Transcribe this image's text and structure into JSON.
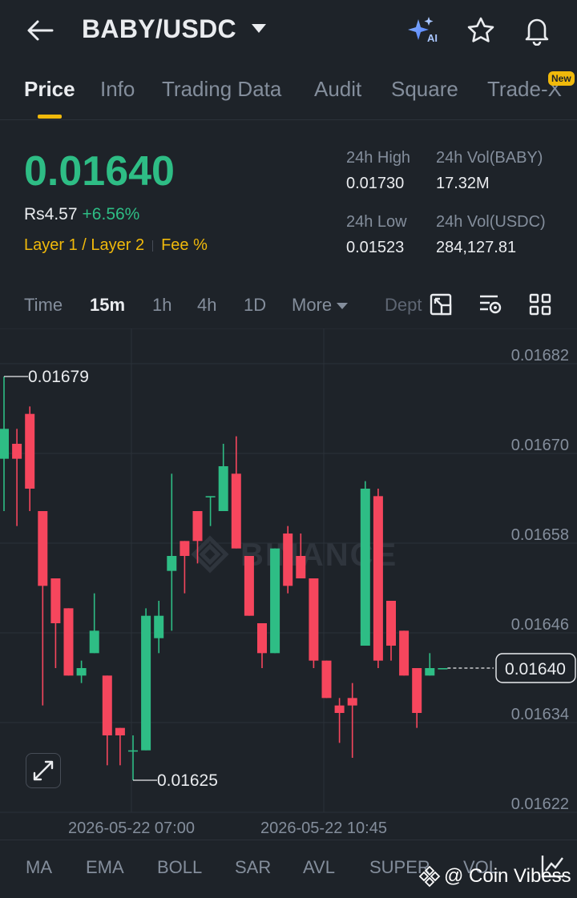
{
  "header": {
    "pair": "BABY/USDC",
    "ai_label": "AI"
  },
  "tabs": [
    {
      "label": "Price",
      "active": true
    },
    {
      "label": "Info"
    },
    {
      "label": "Trading Data"
    },
    {
      "label": "Audit"
    },
    {
      "label": "Square"
    },
    {
      "label": "Trade-X",
      "badge": "New"
    }
  ],
  "price": {
    "last": "0.01640",
    "fiat": "Rs4.57",
    "change": "+6.56%",
    "tag1": "Layer 1 / Layer 2",
    "tag2": "Fee %"
  },
  "stats": {
    "high_label": "24h High",
    "high_value": "0.01730",
    "vol_base_label": "24h Vol(BABY)",
    "vol_base_value": "17.32M",
    "low_label": "24h Low",
    "low_value": "0.01523",
    "vol_quote_label": "24h Vol(USDC)",
    "vol_quote_value": "284,127.81"
  },
  "timeframes": {
    "time": "Time",
    "m15": "15m",
    "h1": "1h",
    "h4": "4h",
    "d1": "1D",
    "more": "More",
    "depth": "Dept"
  },
  "colors": {
    "up": "#2ebd85",
    "down": "#f6465d",
    "accent": "#f0b90b",
    "bg": "#1e2329"
  },
  "chart_data": {
    "type": "candlestick",
    "yticks": [
      "0.01682",
      "0.01670",
      "0.01658",
      "0.01646",
      "0.01634",
      "0.01622"
    ],
    "ylim": [
      0.01622,
      0.01682
    ],
    "xticks": [
      "2026-05-22 07:00",
      "2026-05-22 10:45"
    ],
    "high_marker": "0.01679",
    "low_marker": "0.01625",
    "last_price": "0.01640",
    "watermark": "BINANCE",
    "candles": [
      {
        "o": 0.01668,
        "h": 0.01679,
        "l": 0.01661,
        "c": 0.01672
      },
      {
        "o": 0.0167,
        "h": 0.01672,
        "l": 0.01659,
        "c": 0.01668
      },
      {
        "o": 0.01674,
        "h": 0.01675,
        "l": 0.01661,
        "c": 0.01664
      },
      {
        "o": 0.01661,
        "h": 0.01661,
        "l": 0.01635,
        "c": 0.01651
      },
      {
        "o": 0.01652,
        "h": 0.01652,
        "l": 0.0164,
        "c": 0.01646
      },
      {
        "o": 0.01648,
        "h": 0.01648,
        "l": 0.01639,
        "c": 0.01639
      },
      {
        "o": 0.01639,
        "h": 0.01641,
        "l": 0.01638,
        "c": 0.0164
      },
      {
        "o": 0.01642,
        "h": 0.0165,
        "l": 0.01642,
        "c": 0.01645
      },
      {
        "o": 0.01639,
        "h": 0.01639,
        "l": 0.01627,
        "c": 0.01631
      },
      {
        "o": 0.01632,
        "h": 0.01632,
        "l": 0.01627,
        "c": 0.01631
      },
      {
        "o": 0.01629,
        "h": 0.01631,
        "l": 0.01625,
        "c": 0.01629
      },
      {
        "o": 0.01629,
        "h": 0.01648,
        "l": 0.01629,
        "c": 0.01647
      },
      {
        "o": 0.01644,
        "h": 0.01649,
        "l": 0.01642,
        "c": 0.01647
      },
      {
        "o": 0.01653,
        "h": 0.01666,
        "l": 0.01645,
        "c": 0.01655
      },
      {
        "o": 0.01657,
        "h": 0.01657,
        "l": 0.0165,
        "c": 0.01655
      },
      {
        "o": 0.01661,
        "h": 0.01661,
        "l": 0.01654,
        "c": 0.01657
      },
      {
        "o": 0.01663,
        "h": 0.01663,
        "l": 0.01659,
        "c": 0.01663
      },
      {
        "o": 0.01661,
        "h": 0.0167,
        "l": 0.01661,
        "c": 0.01667
      },
      {
        "o": 0.01666,
        "h": 0.01671,
        "l": 0.01656,
        "c": 0.01656
      },
      {
        "o": 0.01655,
        "h": 0.01655,
        "l": 0.01647,
        "c": 0.01647
      },
      {
        "o": 0.01646,
        "h": 0.01646,
        "l": 0.0164,
        "c": 0.01642
      },
      {
        "o": 0.01642,
        "h": 0.01656,
        "l": 0.01642,
        "c": 0.01656
      },
      {
        "o": 0.01658,
        "h": 0.01659,
        "l": 0.0165,
        "c": 0.01651
      },
      {
        "o": 0.01655,
        "h": 0.01658,
        "l": 0.01652,
        "c": 0.01652
      },
      {
        "o": 0.01652,
        "h": 0.01652,
        "l": 0.0164,
        "c": 0.01641
      },
      {
        "o": 0.01641,
        "h": 0.01641,
        "l": 0.01636,
        "c": 0.01636
      },
      {
        "o": 0.01635,
        "h": 0.01636,
        "l": 0.0163,
        "c": 0.01634
      },
      {
        "o": 0.01636,
        "h": 0.01638,
        "l": 0.01628,
        "c": 0.01635
      },
      {
        "o": 0.01643,
        "h": 0.01665,
        "l": 0.01643,
        "c": 0.01664
      },
      {
        "o": 0.01663,
        "h": 0.01664,
        "l": 0.0164,
        "c": 0.01641
      },
      {
        "o": 0.01649,
        "h": 0.01649,
        "l": 0.01641,
        "c": 0.01643
      },
      {
        "o": 0.01645,
        "h": 0.01645,
        "l": 0.01639,
        "c": 0.01639
      },
      {
        "o": 0.0164,
        "h": 0.0164,
        "l": 0.01632,
        "c": 0.01634
      },
      {
        "o": 0.01639,
        "h": 0.01642,
        "l": 0.01639,
        "c": 0.0164
      },
      {
        "o": 0.0164,
        "h": 0.0164,
        "l": 0.0164,
        "c": 0.0164
      }
    ]
  },
  "indicators": [
    "MA",
    "EMA",
    "BOLL",
    "SAR",
    "AVL",
    "SUPER",
    "VOL"
  ],
  "credit": "@ Coin Vibess"
}
